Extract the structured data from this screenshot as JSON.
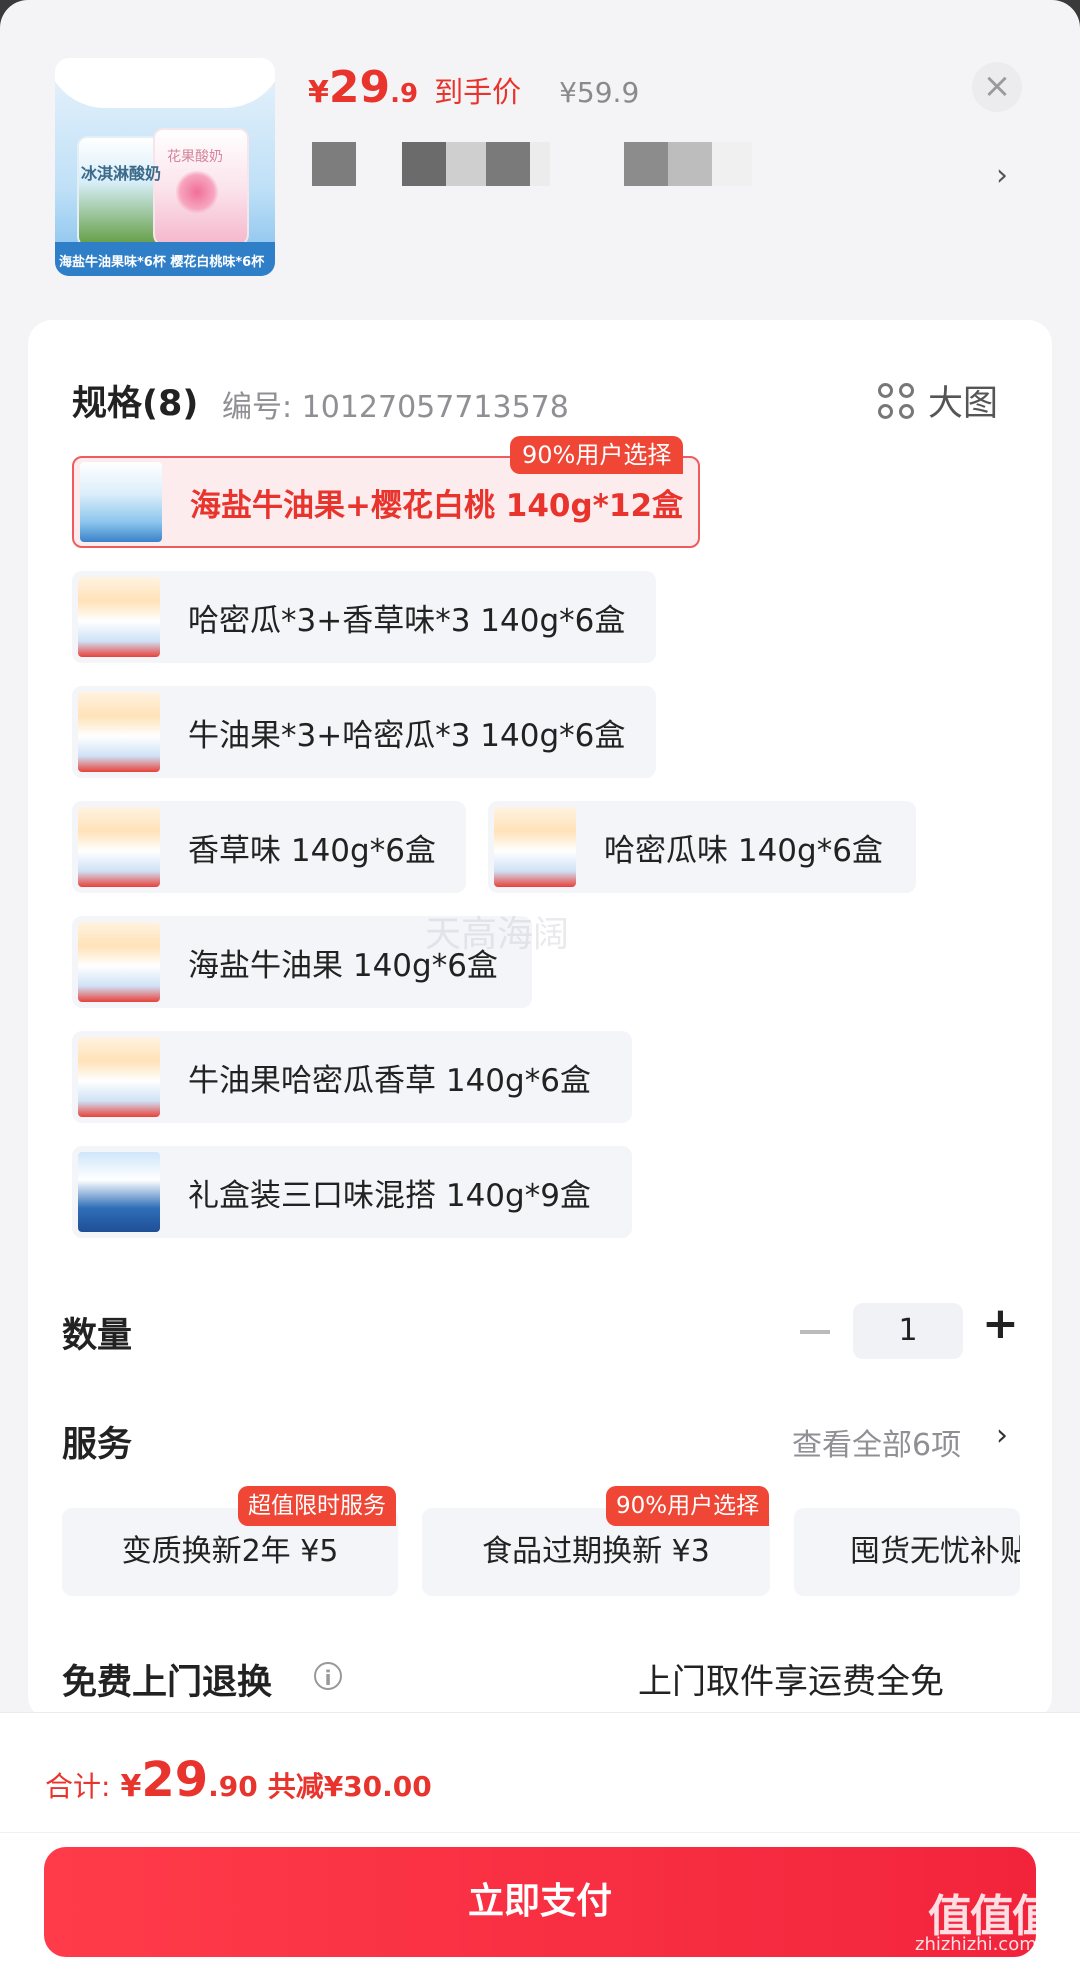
{
  "header": {
    "price_currency": "¥",
    "price_int": "29",
    "price_dec": ".9",
    "price_label": "到手价",
    "original_price": "¥59.9",
    "close_symbol": "×",
    "thumb_caption": "海盐牛油果味*6杯 樱花白桃味*6杯",
    "thumb_cup1_text": "冰淇淋酸奶",
    "thumb_cup2_text": "花果酸奶",
    "chevron": "›"
  },
  "spec": {
    "title": "规格(8)",
    "code": "编号: 10127057713578",
    "big_view_label": "大图",
    "options": [
      {
        "label": "海盐牛油果+樱花白桃 140g*12盒",
        "selected": true,
        "badge": "90%用户选择",
        "pic": "top"
      },
      {
        "label": "哈密瓜*3+香草味*3 140g*6盒",
        "selected": false,
        "badge": "",
        "pic": "std"
      },
      {
        "label": "牛油果*3+哈密瓜*3 140g*6盒",
        "selected": false,
        "badge": "",
        "pic": "std"
      },
      {
        "label": "香草味 140g*6盒",
        "selected": false,
        "badge": "",
        "pic": "std"
      },
      {
        "label": "哈密瓜味 140g*6盒",
        "selected": false,
        "badge": "",
        "pic": "std"
      },
      {
        "label": "海盐牛油果 140g*6盒",
        "selected": false,
        "badge": "",
        "pic": "std"
      },
      {
        "label": "牛油果哈密瓜香草 140g*6盒",
        "selected": false,
        "badge": "",
        "pic": "std"
      },
      {
        "label": "礼盒装三口味混搭 140g*9盒",
        "selected": false,
        "badge": "",
        "pic": "blue"
      }
    ]
  },
  "watermark_text": "天高海阔",
  "quantity": {
    "title": "数量",
    "minus": "−",
    "value": "1",
    "plus": "+"
  },
  "service": {
    "title": "服务",
    "view_all": "查看全部6项",
    "chevron": "›",
    "items": [
      {
        "label": "变质换新2年  ¥5",
        "badge": "超值限时服务"
      },
      {
        "label": "食品过期换新  ¥3",
        "badge": "90%用户选择"
      },
      {
        "label": "囤货无忧补贴",
        "badge": ""
      }
    ]
  },
  "return_service": {
    "title": "免费上门退换",
    "info_icon": "i",
    "description": "上门取件享运费全免"
  },
  "footer": {
    "total_label": "合计:",
    "total_currency": "¥",
    "total_int": "29",
    "total_dec": ".90",
    "total_saving": "共减¥30.00",
    "pay_button": "立即支付",
    "watermark_logo": "值值值",
    "watermark_url": "zhizhizhi.com"
  },
  "colors": {
    "accent": "#e8342c",
    "badge": "#ef4636",
    "pay_button": "#f2243c"
  }
}
